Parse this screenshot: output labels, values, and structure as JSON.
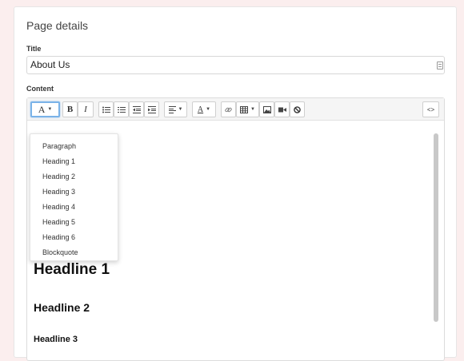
{
  "page": {
    "section_title": "Page details",
    "title_label": "Title",
    "title_value": "About Us",
    "content_label": "Content"
  },
  "toolbar": {
    "style_button": "A",
    "bold": "B",
    "italic": "I",
    "color_button": "A",
    "code_view": "<>"
  },
  "style_menu": {
    "items": [
      "Paragraph",
      "Heading 1",
      "Heading 2",
      "Heading 3",
      "Heading 4",
      "Heading 5",
      "Heading 6",
      "Blockquote"
    ]
  },
  "content": {
    "headline1": "Headline 1",
    "headline2": "Headline 2",
    "headline3": "Headline 3"
  },
  "colors": {
    "background": "#fbeeee",
    "active_border": "#7ab3e8"
  }
}
